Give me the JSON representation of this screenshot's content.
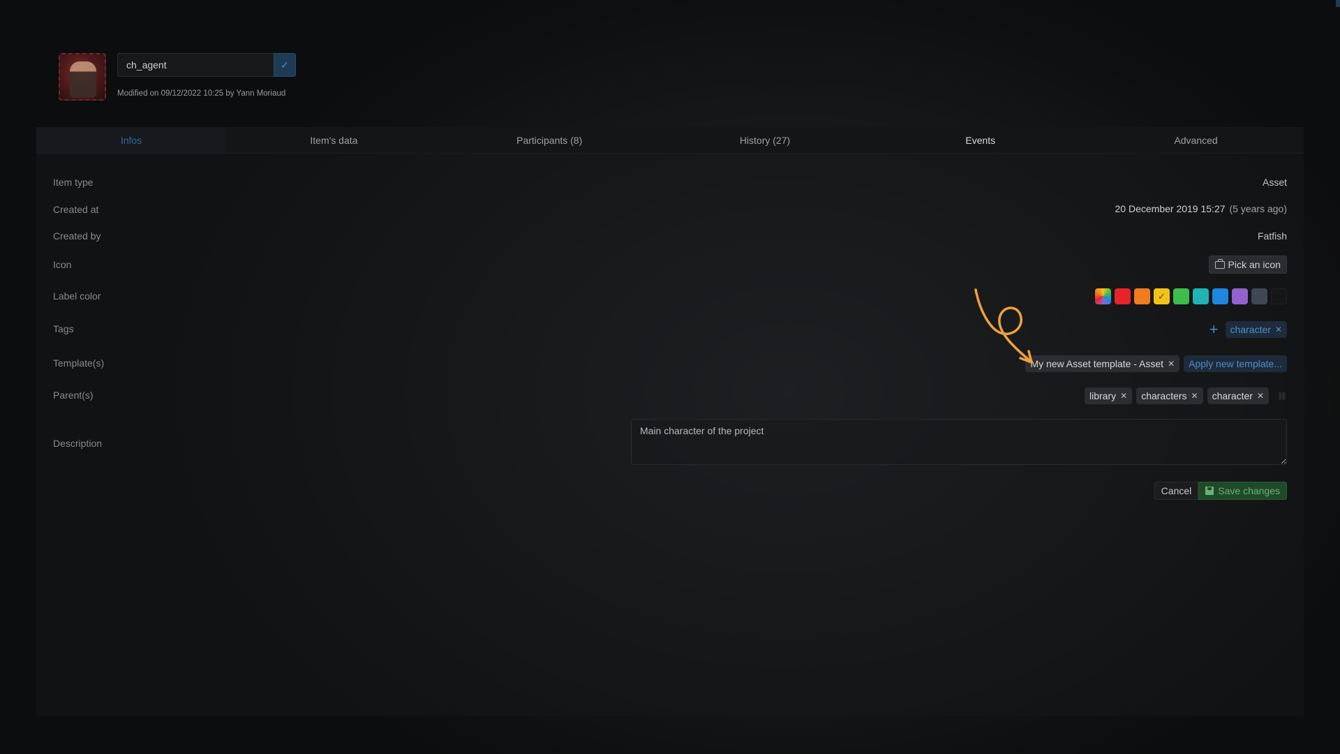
{
  "header": {
    "item_name": "ch_agent",
    "modified_text": "Modified on 09/12/2022 10:25 by Yann Moriaud"
  },
  "tabs": [
    {
      "label": "Infos",
      "active": true
    },
    {
      "label": "Item's data"
    },
    {
      "label": "Participants (8)"
    },
    {
      "label": "History (27)"
    },
    {
      "label": "Events"
    },
    {
      "label": "Advanced"
    }
  ],
  "fields": {
    "item_type": {
      "label": "Item type",
      "value": "Asset"
    },
    "created_at": {
      "label": "Created at",
      "date": "20 December 2019 15:27",
      "ago": "(5 years ago)"
    },
    "created_by": {
      "label": "Created by",
      "value": "Fatfish"
    },
    "icon": {
      "label": "Icon",
      "button": "Pick an icon"
    },
    "label_color": {
      "label": "Label color",
      "colors": [
        "multicolor",
        "#e8232a",
        "#f07c1f",
        "#f2c21b",
        "#3dbd4a",
        "#1fb3b3",
        "#1e87e0",
        "#9362cf",
        "#3f4756",
        "#151618"
      ],
      "selected_index": 3
    },
    "tags": {
      "label": "Tags",
      "chips": [
        "character"
      ]
    },
    "templates": {
      "label": "Template(s)",
      "chips": [
        "My new Asset template - Asset"
      ],
      "apply_label": "Apply new template..."
    },
    "parents": {
      "label": "Parent(s)",
      "chips": [
        "library",
        "characters",
        "character"
      ]
    },
    "description": {
      "label": "Description",
      "value": "Main character of the project"
    }
  },
  "actions": {
    "cancel": "Cancel",
    "save": "Save changes"
  },
  "annotation": {
    "color": "#f0a23a"
  }
}
